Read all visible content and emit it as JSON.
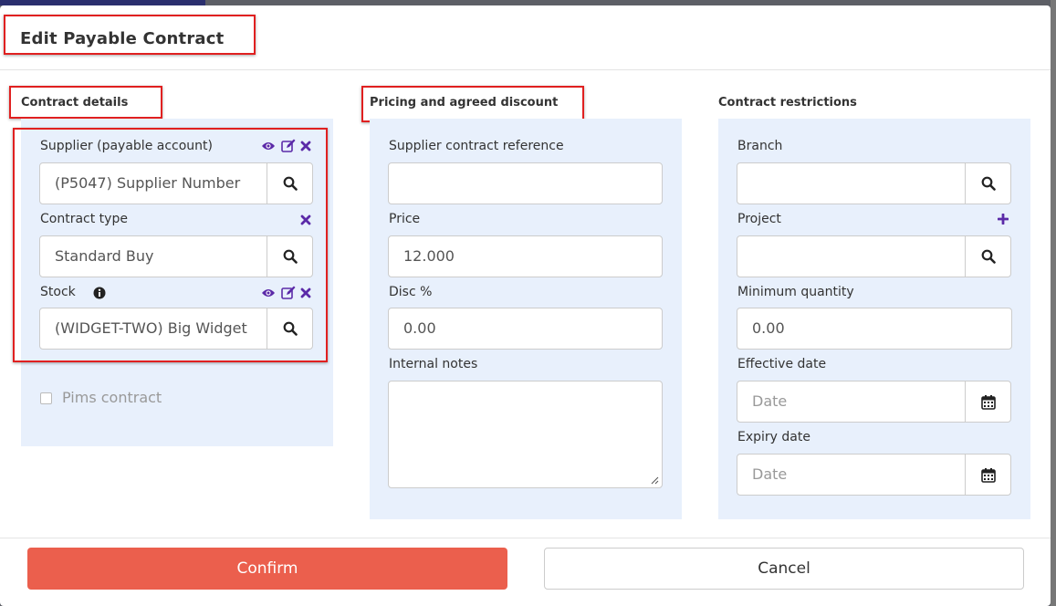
{
  "modal": {
    "title": "Edit Payable Contract"
  },
  "contract_details": {
    "title": "Contract details",
    "supplier": {
      "label": "Supplier (payable account)",
      "value": "(P5047) Supplier Number"
    },
    "contract_type": {
      "label": "Contract type",
      "value": "Standard Buy"
    },
    "stock": {
      "label": "Stock",
      "value": "(WIDGET-TWO) Big Widget"
    },
    "pims": {
      "label": "Pims contract"
    }
  },
  "pricing": {
    "title": "Pricing and agreed discount",
    "reference": {
      "label": "Supplier contract reference",
      "value": ""
    },
    "price": {
      "label": "Price",
      "value": "12.000"
    },
    "disc": {
      "label": "Disc %",
      "value": "0.00"
    },
    "notes": {
      "label": "Internal notes",
      "value": ""
    }
  },
  "restrictions": {
    "title": "Contract restrictions",
    "branch": {
      "label": "Branch",
      "value": ""
    },
    "project": {
      "label": "Project",
      "value": ""
    },
    "min_qty": {
      "label": "Minimum quantity",
      "value": "0.00"
    },
    "effective": {
      "label": "Effective date",
      "placeholder": "Date"
    },
    "expiry": {
      "label": "Expiry date",
      "placeholder": "Date"
    }
  },
  "footer": {
    "confirm": "Confirm",
    "cancel": "Cancel"
  },
  "colors": {
    "accent_purple": "#5b2aa8",
    "confirm": "#eb5f4d",
    "panel": "#e8f0fc",
    "highlight": "#e02020"
  },
  "icons": [
    "eye-icon",
    "edit-icon",
    "remove-icon",
    "search-icon",
    "info-icon",
    "plus-icon",
    "calendar-icon"
  ]
}
